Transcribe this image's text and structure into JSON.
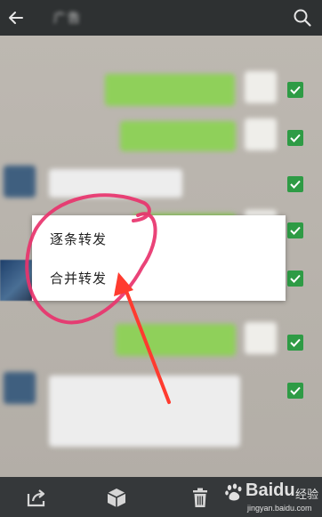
{
  "header": {
    "back_icon": "arrow-left-icon",
    "title": "广告",
    "search_icon": "search-icon"
  },
  "messages": [
    {
      "side": "right",
      "type": "text"
    },
    {
      "side": "right",
      "type": "text"
    },
    {
      "side": "left",
      "type": "text"
    },
    {
      "side": "right",
      "type": "text"
    },
    {
      "side": "left",
      "type": "image"
    },
    {
      "side": "right",
      "type": "text"
    },
    {
      "side": "left",
      "type": "text"
    }
  ],
  "selection": {
    "checked_count": 7,
    "check_color": "#2e9b45"
  },
  "popup": {
    "items": [
      {
        "label": "逐条转发"
      },
      {
        "label": "合并转发"
      }
    ]
  },
  "annotation": {
    "color": "#e8336d"
  },
  "toolbar": {
    "buttons": [
      "share-icon",
      "box-icon",
      "trash-icon"
    ]
  },
  "watermark": {
    "brand": "Baidu",
    "brand_cn": "经验",
    "url": "jingyan.baidu.com"
  },
  "colors": {
    "header_bg": "#2e3132",
    "toolbar_bg": "#35383a",
    "bubble_green": "#8fd05a"
  }
}
